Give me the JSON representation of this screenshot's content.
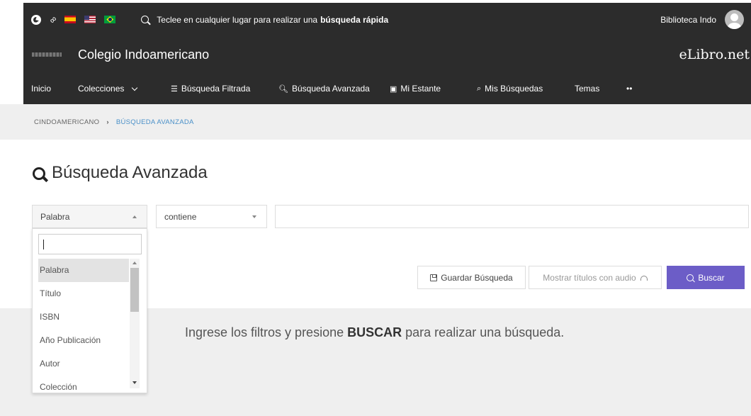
{
  "topbar": {
    "quick_search_prefix": "Teclee en cualquier lugar para realizar una",
    "quick_search_bold": "búsqueda rápida",
    "user_name": "Biblioteca Indo"
  },
  "brand": {
    "school_name": "Colegio Indoamericano",
    "site_logo": "eLibro.net"
  },
  "nav": {
    "items": [
      {
        "label": "Inicio",
        "icon": ""
      },
      {
        "label": "Colecciones",
        "icon": "chevron-down"
      },
      {
        "label": "Búsqueda Filtrada",
        "icon": "filter-icon"
      },
      {
        "label": "Búsqueda Avanzada",
        "icon": "search-icon"
      },
      {
        "label": "Mi Estante",
        "icon": "shelf-icon"
      },
      {
        "label": "Mis Búsquedas",
        "icon": "search-outline-icon"
      },
      {
        "label": "Temas",
        "icon": ""
      },
      {
        "label": "••",
        "icon": ""
      }
    ]
  },
  "breadcrumb": {
    "root": "CINDOAMERICANO",
    "current": "BÚSQUEDA AVANZADA"
  },
  "page": {
    "title": "Búsqueda Avanzada"
  },
  "filters": {
    "field_value": "Palabra",
    "operator_value": "contiene",
    "search_text": "",
    "dropdown_filter_text": "",
    "options": [
      "Palabra",
      "Título",
      "ISBN",
      "Año Publicación",
      "Autor",
      "Colección"
    ],
    "selected_option": "Palabra"
  },
  "actions": {
    "save_label": "Guardar Búsqueda",
    "audio_label": "Mostrar títulos con audio",
    "search_label": "Buscar"
  },
  "results": {
    "msg_prefix": "Ingrese los filtros y presione",
    "msg_bold": "BUSCAR",
    "msg_suffix": "para realizar una búsqueda."
  },
  "colors": {
    "topbar_bg": "#2c2c2c",
    "accent": "#6c5dc7",
    "breadcrumb_link": "#4a90c8"
  }
}
